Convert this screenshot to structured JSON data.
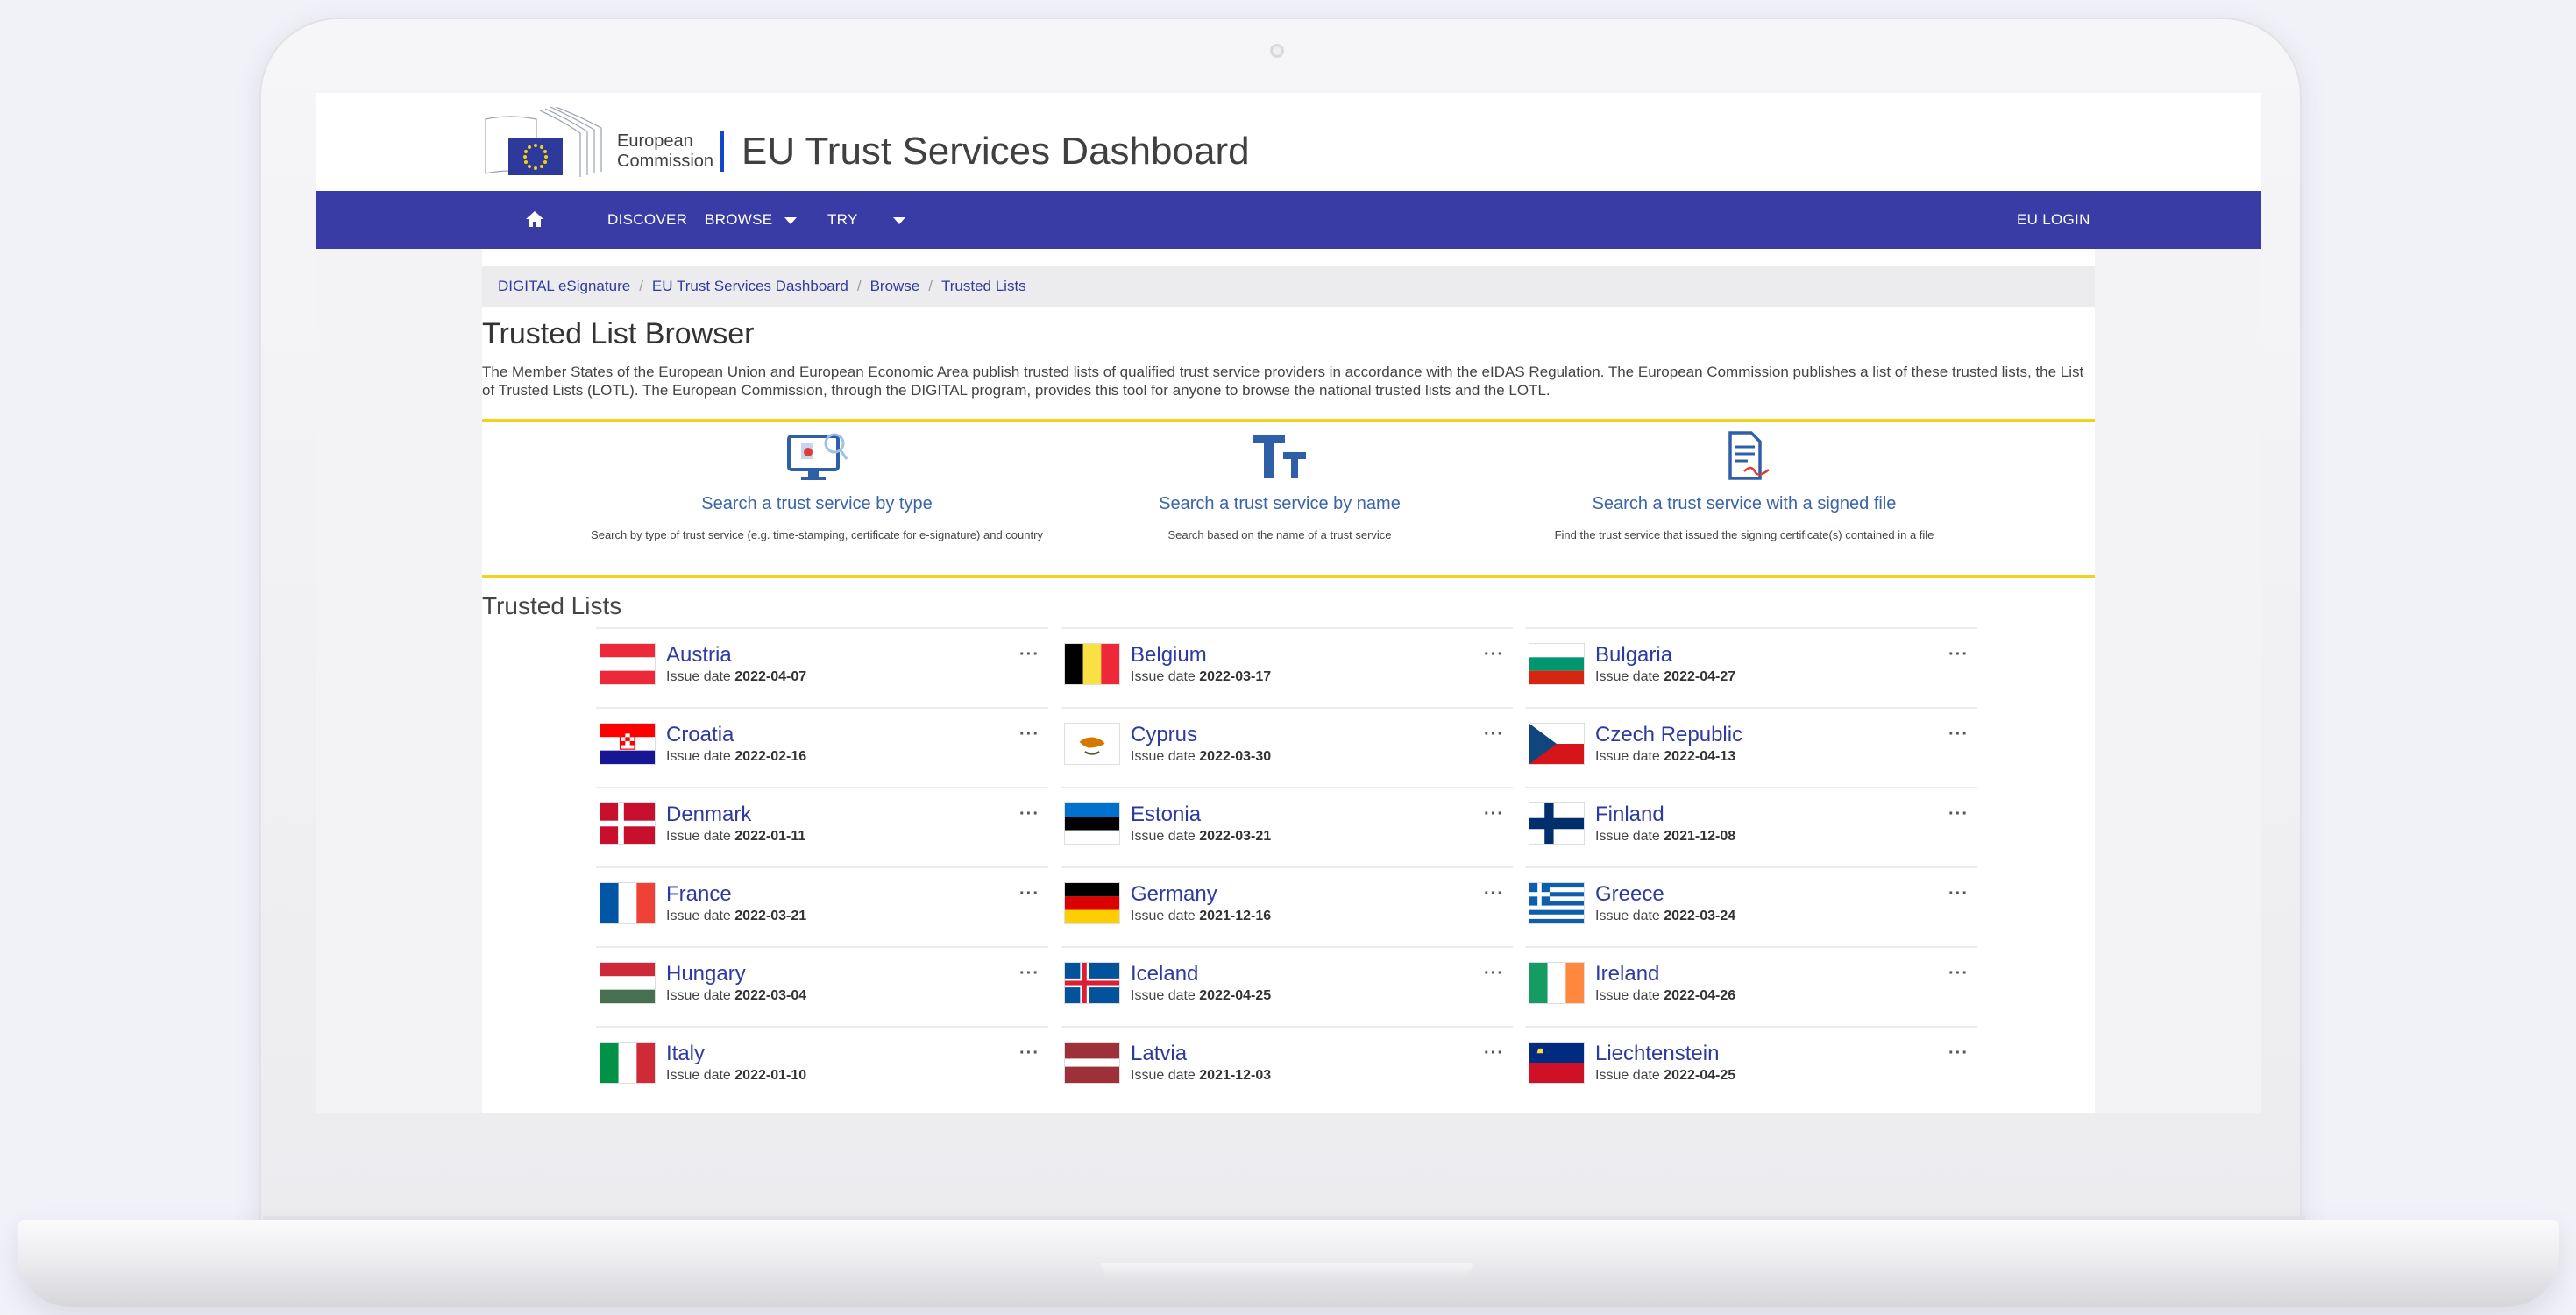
{
  "header": {
    "logo_line1": "European",
    "logo_line2": "Commission",
    "title": "EU Trust Services Dashboard"
  },
  "nav": {
    "home_icon": "home-icon",
    "discover": "DISCOVER",
    "browse": "BROWSE",
    "try": "TRY",
    "login": "EU LOGIN"
  },
  "breadcrumb": [
    "DIGITAL eSignature",
    "EU Trust Services Dashboard",
    "Browse",
    "Trusted Lists"
  ],
  "page": {
    "heading": "Trusted List Browser",
    "intro": "The Member States of the European Union and European Economic Area publish trusted lists of qualified trust service providers in accordance with the eIDAS Regulation. The European Commission publishes a list of these trusted lists, the List of Trusted Lists (LOTL). The European Commission, through the DIGITAL program, provides this tool for anyone to browse the national trusted lists and the LOTL.",
    "section_heading": "Trusted Lists"
  },
  "search_options": [
    {
      "icon": "computer-search-icon",
      "title": "Search a trust service by type",
      "desc": "Search by type of trust service (e.g. time-stamping, certificate for e-signature) and country"
    },
    {
      "icon": "text-size-icon",
      "title": "Search a trust service by name",
      "desc": "Search based on the name of a trust service"
    },
    {
      "icon": "signed-document-icon",
      "title": "Search a trust service with a signed file",
      "desc": "Find the trust service that issued the signing certificate(s) contained in a file"
    }
  ],
  "issue_label": "Issue date",
  "countries": [
    {
      "name": "Austria",
      "date": "2022-04-07",
      "flag": "austria-flag"
    },
    {
      "name": "Belgium",
      "date": "2022-03-17",
      "flag": "belgium-flag"
    },
    {
      "name": "Bulgaria",
      "date": "2022-04-27",
      "flag": "bulgaria-flag"
    },
    {
      "name": "Croatia",
      "date": "2022-02-16",
      "flag": "croatia-flag"
    },
    {
      "name": "Cyprus",
      "date": "2022-03-30",
      "flag": "cyprus-flag"
    },
    {
      "name": "Czech Republic",
      "date": "2022-04-13",
      "flag": "czech-republic-flag"
    },
    {
      "name": "Denmark",
      "date": "2022-01-11",
      "flag": "denmark-flag"
    },
    {
      "name": "Estonia",
      "date": "2022-03-21",
      "flag": "estonia-flag"
    },
    {
      "name": "Finland",
      "date": "2021-12-08",
      "flag": "finland-flag"
    },
    {
      "name": "France",
      "date": "2022-03-21",
      "flag": "france-flag"
    },
    {
      "name": "Germany",
      "date": "2021-12-16",
      "flag": "germany-flag"
    },
    {
      "name": "Greece",
      "date": "2022-03-24",
      "flag": "greece-flag"
    },
    {
      "name": "Hungary",
      "date": "2022-03-04",
      "flag": "hungary-flag"
    },
    {
      "name": "Iceland",
      "date": "2022-04-25",
      "flag": "iceland-flag"
    },
    {
      "name": "Ireland",
      "date": "2022-04-26",
      "flag": "ireland-flag"
    },
    {
      "name": "Italy",
      "date": "2022-01-10",
      "flag": "italy-flag"
    },
    {
      "name": "Latvia",
      "date": "2021-12-03",
      "flag": "latvia-flag"
    },
    {
      "name": "Liechtenstein",
      "date": "2022-04-25",
      "flag": "liechtenstein-flag"
    }
  ],
  "colors": {
    "nav_bar": "#3a3ca6",
    "accent_line": "#f2d21b",
    "link": "#2d3aa0"
  }
}
